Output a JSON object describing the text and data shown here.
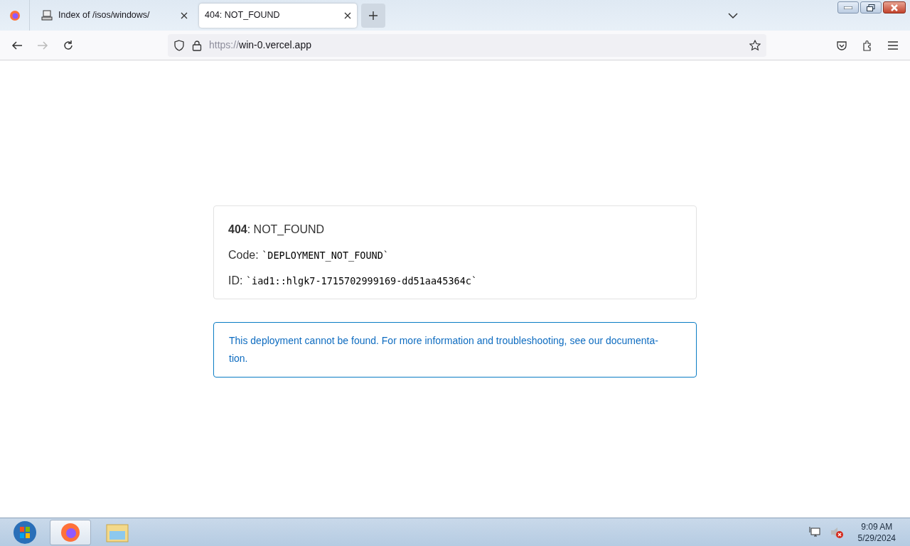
{
  "tabs": [
    {
      "title": "Index of /isos/windows/",
      "selected": false
    },
    {
      "title": "404: NOT_FOUND",
      "selected": true
    }
  ],
  "address_bar": {
    "scheme": "https://",
    "host": "win-0.vercel.app"
  },
  "error_card": {
    "heading_code": "404",
    "heading_text": ": NOT_FOUND",
    "code_label": "Code:",
    "code_value": "`DEPLOYMENT_NOT_FOUND`",
    "id_label": "ID:",
    "id_value": "`iad1::hlgk7-1715702999169-dd51aa45364c`"
  },
  "note_lines": [
    "This deployment cannot be found. For more information and troubleshooting, see our documenta-",
    "tion."
  ],
  "taskbar": {
    "apps": [
      {
        "kind": "firefox",
        "selected": true
      },
      {
        "kind": "explorer",
        "selected": false
      }
    ],
    "time": "9:09 AM",
    "date": "5/29/2024"
  }
}
